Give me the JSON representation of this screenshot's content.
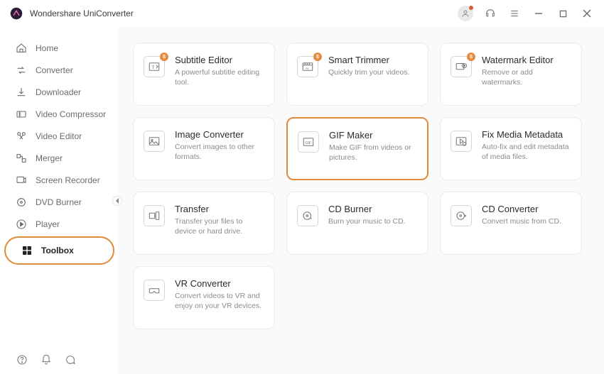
{
  "app_title": "Wondershare UniConverter",
  "sidebar": {
    "items": [
      {
        "label": "Home",
        "icon": "home-icon"
      },
      {
        "label": "Converter",
        "icon": "converter-icon"
      },
      {
        "label": "Downloader",
        "icon": "downloader-icon"
      },
      {
        "label": "Video Compressor",
        "icon": "compressor-icon"
      },
      {
        "label": "Video Editor",
        "icon": "editor-icon"
      },
      {
        "label": "Merger",
        "icon": "merger-icon"
      },
      {
        "label": "Screen Recorder",
        "icon": "screen-recorder-icon"
      },
      {
        "label": "DVD Burner",
        "icon": "dvd-icon"
      },
      {
        "label": "Player",
        "icon": "player-icon"
      },
      {
        "label": "Toolbox",
        "icon": "toolbox-icon",
        "active": true
      }
    ]
  },
  "tools": [
    {
      "title": "Subtitle Editor",
      "desc": "A powerful subtitle editing tool.",
      "icon": "subtitle-icon",
      "premium": true
    },
    {
      "title": "Smart Trimmer",
      "desc": "Quickly trim your videos.",
      "icon": "smart-trimmer-icon",
      "premium": true
    },
    {
      "title": "Watermark Editor",
      "desc": "Remove or add watermarks.",
      "icon": "watermark-icon",
      "premium": true
    },
    {
      "title": "Image Converter",
      "desc": "Convert images to other formats.",
      "icon": "image-converter-icon",
      "premium": false
    },
    {
      "title": "GIF Maker",
      "desc": "Make GIF from videos or pictures.",
      "icon": "gif-maker-icon",
      "premium": false,
      "highlight": true
    },
    {
      "title": "Fix Media Metadata",
      "desc": "Auto-fix and edit metadata of media files.",
      "icon": "metadata-icon",
      "premium": false
    },
    {
      "title": "Transfer",
      "desc": "Transfer your files to device or hard drive.",
      "icon": "transfer-icon",
      "premium": false
    },
    {
      "title": "CD Burner",
      "desc": "Burn your music to CD.",
      "icon": "cd-burner-icon",
      "premium": false
    },
    {
      "title": "CD Converter",
      "desc": "Convert music from CD.",
      "icon": "cd-converter-icon",
      "premium": false
    },
    {
      "title": "VR Converter",
      "desc": "Convert videos to VR and enjoy on your VR devices.",
      "icon": "vr-icon",
      "premium": false
    }
  ],
  "premium_badge": "$"
}
